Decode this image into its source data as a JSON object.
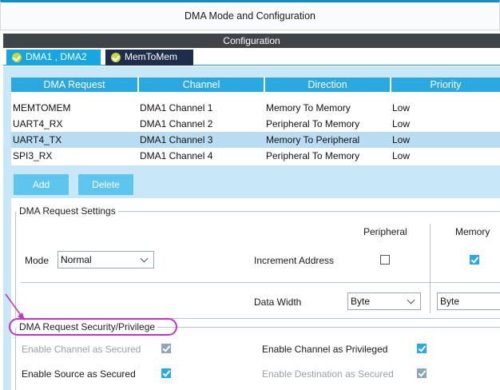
{
  "window": {
    "title": "DMA Mode and Configuration"
  },
  "config": {
    "header": "Configuration"
  },
  "tabs": [
    {
      "label": "DMA1 , DMA2",
      "active": true
    },
    {
      "label": "MemToMem",
      "active": false
    }
  ],
  "table": {
    "headers": [
      "DMA Request",
      "Channel",
      "Direction",
      "Priority"
    ],
    "rows": [
      [
        "MEMTOMEM",
        "DMA1 Channel 1",
        "Memory To Memory",
        "Low"
      ],
      [
        "UART4_RX",
        "DMA1 Channel 2",
        "Peripheral To Memory",
        "Low"
      ],
      [
        "UART4_TX",
        "DMA1 Channel 3",
        "Memory To Peripheral",
        "Low"
      ],
      [
        "SPI3_RX",
        "DMA1 Channel 4",
        "Peripheral To Memory",
        "Low"
      ]
    ],
    "selected_row_index": 2
  },
  "buttons": {
    "add": "Add",
    "delete": "Delete"
  },
  "settings": {
    "legend": "DMA Request Settings",
    "col_peripheral": "Peripheral",
    "col_memory": "Memory",
    "mode_label": "Mode",
    "mode_value": "Normal",
    "increment_label": "Increment Address",
    "increment_peripheral_checked": false,
    "increment_memory_checked": true,
    "data_width_label": "Data Width",
    "data_width_peripheral": "Byte",
    "data_width_memory": "Byte"
  },
  "security": {
    "legend": "DMA Request Security/Privilege",
    "enable_channel_secured": {
      "label": "Enable Channel as Secured",
      "checked": true,
      "enabled": false
    },
    "enable_channel_privileged": {
      "label": "Enable Channel as Privileged",
      "checked": true,
      "enabled": true
    },
    "enable_source_secured": {
      "label": "Enable Source as Secured",
      "checked": true,
      "enabled": true
    },
    "enable_destination_secured": {
      "label": "Enable Destination as Secured",
      "checked": true,
      "enabled": false
    }
  },
  "colors": {
    "accent": "#29a9e0",
    "panel_bg": "#c8e8f8",
    "header_dark": "#3e4448",
    "tab_dark": "#1f2d4d",
    "annotation": "#c233c8"
  }
}
